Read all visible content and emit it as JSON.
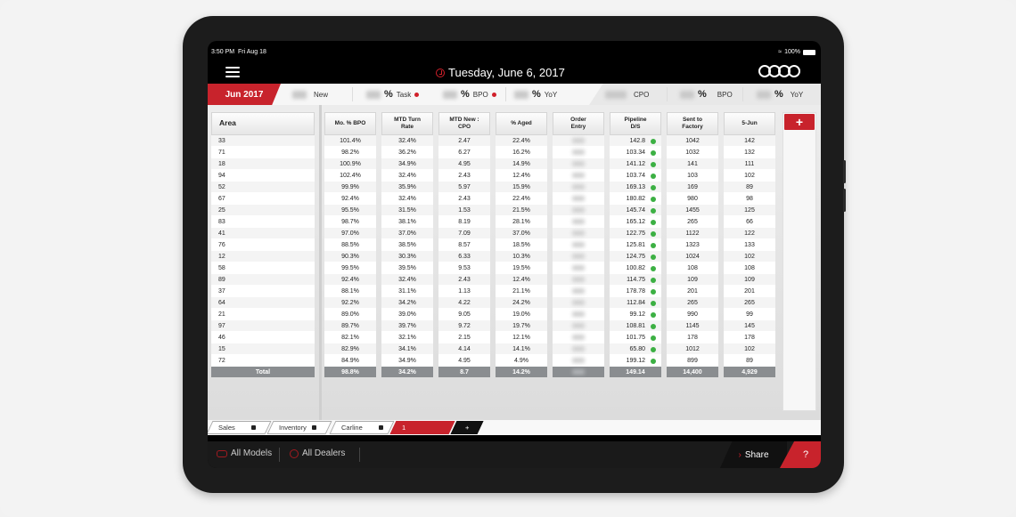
{
  "status": {
    "time": "3:50 PM",
    "date": "Fri Aug 18",
    "battery": "100%"
  },
  "header": {
    "title": "Tuesday, June 6, 2017"
  },
  "kpi": {
    "month": "Jun 2017",
    "items": [
      {
        "pct": "",
        "label": "New"
      },
      {
        "pct": "%",
        "label": "Task"
      },
      {
        "pct": "%",
        "label": "BPO"
      },
      {
        "pct": "%",
        "label": "YoY"
      },
      {
        "pct": "",
        "label": "CPO"
      },
      {
        "pct": "%",
        "label": "BPO"
      },
      {
        "pct": "%",
        "label": "YoY"
      }
    ]
  },
  "table": {
    "area_header": "Area",
    "area_total": "Total",
    "areas": [
      "33",
      "71",
      "18",
      "94",
      "52",
      "67",
      "25",
      "83",
      "41",
      "76",
      "12",
      "58",
      "89",
      "37",
      "64",
      "21",
      "97",
      "46",
      "15",
      "72"
    ],
    "columns": [
      {
        "header": "Mo. % BPO",
        "values": [
          "101.4%",
          "98.2%",
          "100.9%",
          "102.4%",
          "99.9%",
          "92.4%",
          "95.5%",
          "98.7%",
          "97.0%",
          "88.5%",
          "90.3%",
          "99.5%",
          "92.4%",
          "88.1%",
          "92.2%",
          "89.0%",
          "89.7%",
          "82.1%",
          "82.9%",
          "84.9%"
        ],
        "total": "98.8%"
      },
      {
        "header": "MTD Turn\nRate",
        "values": [
          "32.4%",
          "36.2%",
          "34.9%",
          "32.4%",
          "35.9%",
          "32.4%",
          "31.5%",
          "38.1%",
          "37.0%",
          "38.5%",
          "30.3%",
          "39.5%",
          "32.4%",
          "31.1%",
          "34.2%",
          "39.0%",
          "39.7%",
          "32.1%",
          "34.1%",
          "34.9%"
        ],
        "total": "34.2%"
      },
      {
        "header": "MTD New :\nCPO",
        "values": [
          "2.47",
          "6.27",
          "4.95",
          "2.43",
          "5.97",
          "2.43",
          "1.53",
          "8.19",
          "7.09",
          "8.57",
          "6.33",
          "9.53",
          "2.43",
          "1.13",
          "4.22",
          "9.05",
          "9.72",
          "2.15",
          "4.14",
          "4.95"
        ],
        "total": "8.7"
      },
      {
        "header": "% Aged",
        "values": [
          "22.4%",
          "16.2%",
          "14.9%",
          "12.4%",
          "15.9%",
          "22.4%",
          "21.5%",
          "28.1%",
          "37.0%",
          "18.5%",
          "10.3%",
          "19.5%",
          "12.4%",
          "21.1%",
          "24.2%",
          "19.0%",
          "19.7%",
          "12.1%",
          "14.1%",
          "4.9%"
        ],
        "total": "14.2%"
      },
      {
        "header": "Order\nEntry",
        "values": [],
        "total": ""
      },
      {
        "header": "Pipeline\nD/S",
        "values": [
          "142.8",
          "103.34",
          "141.12",
          "103.74",
          "169.13",
          "180.82",
          "145.74",
          "165.12",
          "122.75",
          "125.81",
          "124.75",
          "100.82",
          "114.75",
          "178.78",
          "112.84",
          "99.12",
          "108.81",
          "101.75",
          "65.80",
          "199.12"
        ],
        "total": "149.14"
      },
      {
        "header": "Sent to\nFactory",
        "values": [
          "1042",
          "1032",
          "141",
          "103",
          "169",
          "980",
          "1455",
          "265",
          "1122",
          "1323",
          "1024",
          "108",
          "109",
          "201",
          "265",
          "990",
          "1145",
          "178",
          "1012",
          "899"
        ],
        "total": "14,400"
      },
      {
        "header": "5-Jun",
        "values": [
          "142",
          "132",
          "111",
          "102",
          "89",
          "98",
          "125",
          "66",
          "122",
          "133",
          "102",
          "108",
          "109",
          "201",
          "265",
          "99",
          "145",
          "178",
          "102",
          "89"
        ],
        "total": "4,929"
      }
    ]
  },
  "add_label": "+",
  "sheets": [
    {
      "label": "Sales"
    },
    {
      "label": "Inventory"
    },
    {
      "label": "Carline"
    },
    {
      "label": "1"
    },
    {
      "label": "+"
    }
  ],
  "bottom": {
    "models": "All Models",
    "dealers": "All Dealers",
    "share": "Share",
    "help": "?"
  },
  "colors": {
    "brand_red": "#c8232c",
    "status_green": "#3cb043",
    "total_gray": "#8a8d90"
  }
}
